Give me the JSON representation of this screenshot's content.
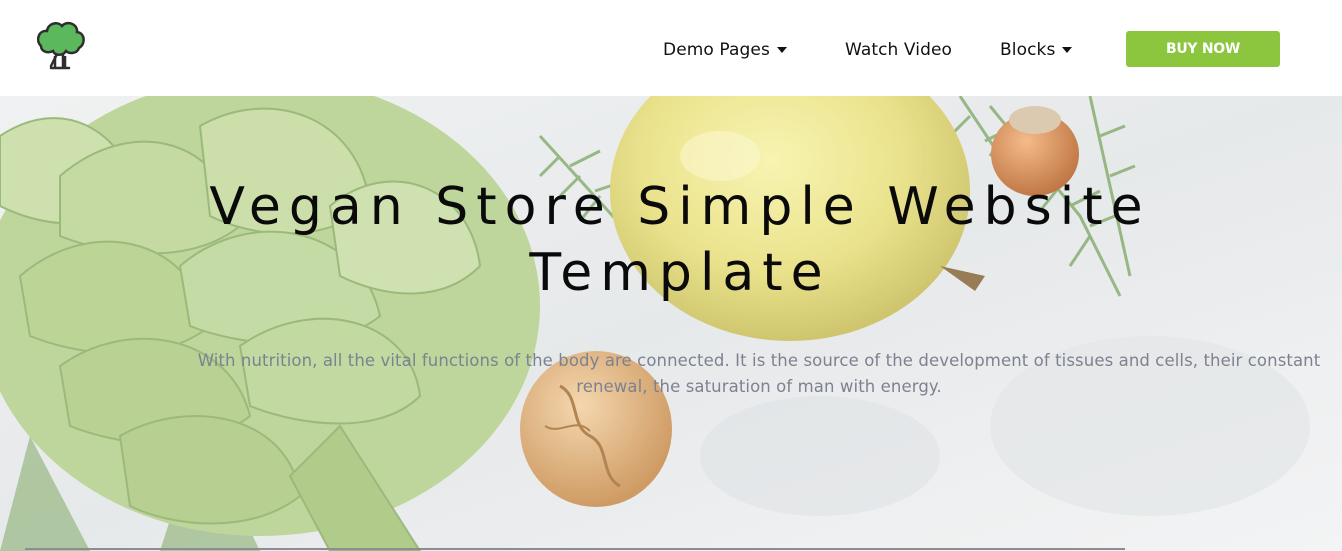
{
  "header": {
    "logo_icon": "broccoli-tree-icon",
    "nav": [
      {
        "label": "Demo Pages",
        "dropdown": true
      },
      {
        "label": "Watch Video",
        "dropdown": false
      },
      {
        "label": "Blocks",
        "dropdown": true
      }
    ],
    "cta_label": "BUY NOW",
    "cta_color": "#8cc63f"
  },
  "hero": {
    "title": "Vegan Store Simple Website Template",
    "text": "With nutrition, all the vital functions of the body are connected. It is the source of the development of tissues and cells, their constant renewal, the saturation of man with energy.",
    "background": "artichoke, pear, hazelnut and walnut on concrete"
  }
}
